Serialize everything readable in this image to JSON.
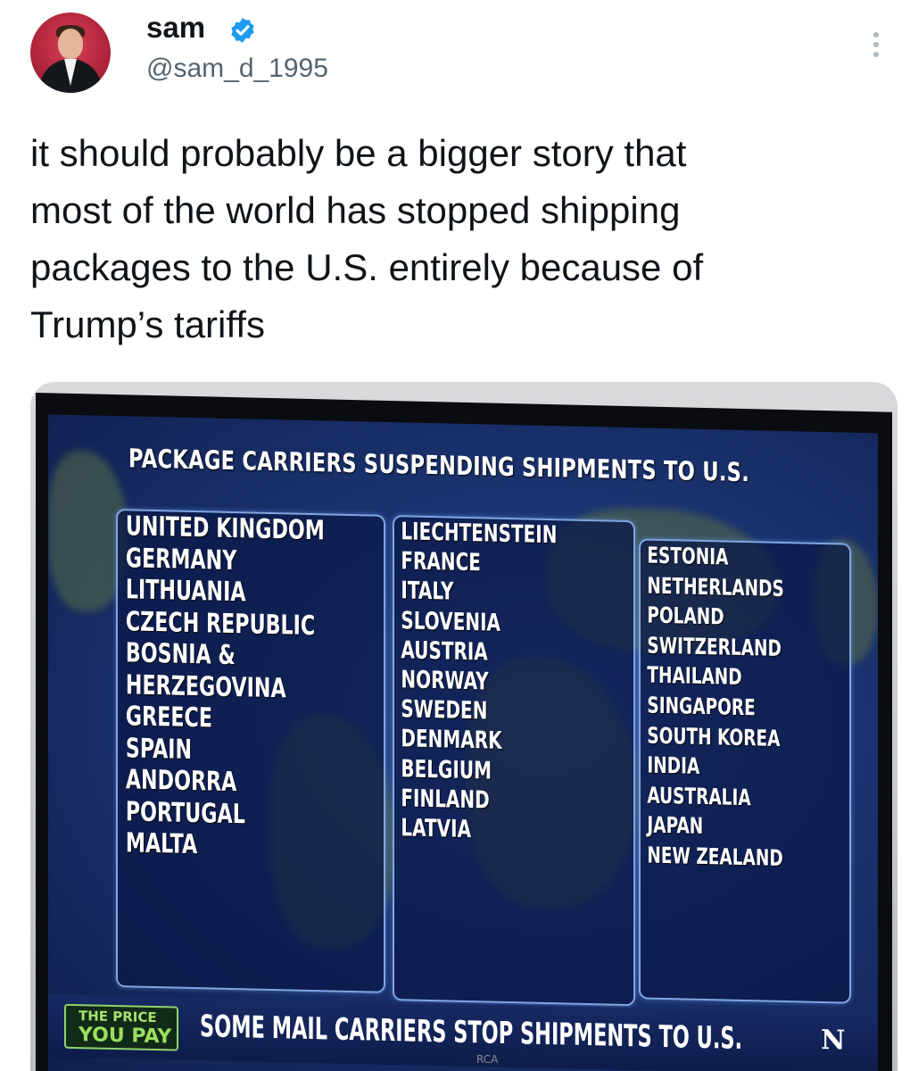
{
  "tweet": {
    "author_name": "sam",
    "handle": "@sam_d_1995",
    "text": "it should probably be a bigger story that\nmost of the world has stopped shipping\npackages to the U.S. entirely because of\nTrump’s tariffs"
  },
  "icons": {
    "verified": "verified-badge-icon",
    "more": "more-options-icon"
  },
  "colors": {
    "verified_blue": "#1d9bf0",
    "handle_gray": "#536471",
    "screen_blue": "#1b3370",
    "logo_green": "#9be05e"
  },
  "media": {
    "headline": "PACKAGE CARRIERS SUSPENDING SHIPMENTS TO U.S.",
    "column1": [
      "UNITED KINGDOM",
      "GERMANY",
      "LITHUANIA",
      "CZECH REPUBLIC",
      "BOSNIA &",
      "HERZEGOVINA",
      "GREECE",
      "SPAIN",
      "ANDORRA",
      "PORTUGAL",
      "MALTA"
    ],
    "column2": [
      "LIECHTENSTEIN",
      "FRANCE",
      "ITALY",
      "SLOVENIA",
      "AUSTRIA",
      "NORWAY",
      "SWEDEN",
      "DENMARK",
      "BELGIUM",
      "FINLAND",
      "LATVIA"
    ],
    "column3": [
      "ESTONIA",
      "NETHERLANDS",
      "POLAND",
      "SWITZERLAND",
      "THAILAND",
      "SINGAPORE",
      "SOUTH KOREA",
      "INDIA",
      "AUSTRALIA",
      "JAPAN",
      "NEW ZEALAND"
    ],
    "show_logo_line1": "THE PRICE",
    "show_logo_line2": "YOU PAY",
    "ticker": "SOME MAIL CARRIERS STOP SHIPMENTS TO U.S.",
    "network_logo": "N",
    "tv_brand": "RCA"
  }
}
